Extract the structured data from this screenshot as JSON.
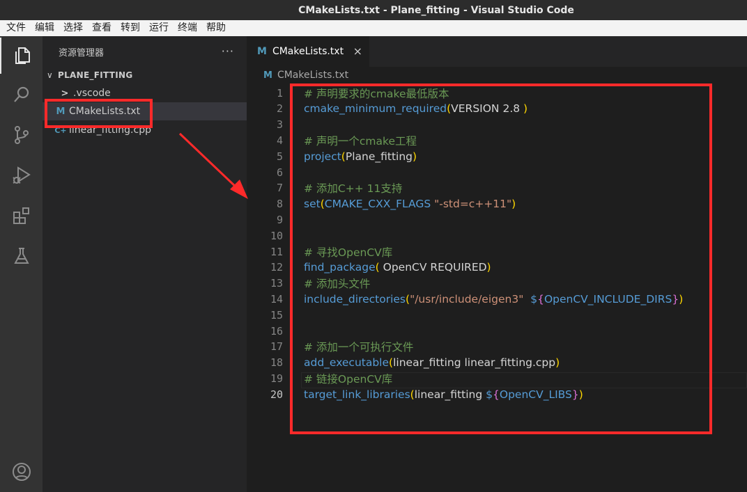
{
  "window": {
    "title": "CMakeLists.txt - Plane_fitting - Visual Studio Code"
  },
  "menu": [
    "文件",
    "编辑",
    "选择",
    "查看",
    "转到",
    "运行",
    "终端",
    "帮助"
  ],
  "activity_bar": [
    "explorer-icon",
    "search-icon",
    "source-control-icon",
    "run-debug-icon",
    "extensions-icon",
    "testing-icon",
    "account-icon"
  ],
  "explorer": {
    "title": "资源管理器",
    "more": "···",
    "folder": "PLANE_FITTING",
    "items": [
      {
        "name": ".vscode",
        "icon": "chevron-right-icon",
        "glyph": ">"
      },
      {
        "name": "CMakeLists.txt",
        "icon": "cmake-file-icon",
        "glyph": "M"
      },
      {
        "name": "linear_fitting.cpp",
        "icon": "cpp-file-icon",
        "glyph": "C+"
      }
    ]
  },
  "editor": {
    "tab": {
      "label": "CMakeLists.txt",
      "icon_glyph": "M",
      "close": "×"
    },
    "breadcrumb": "CMakeLists.txt",
    "current_line": 20,
    "lines": [
      [
        [
          "comment",
          "# 声明要求的cmake最低版本"
        ]
      ],
      [
        [
          "fn",
          "cmake_minimum_required"
        ],
        [
          "paren",
          "("
        ],
        [
          "plain",
          "VERSION 2.8 "
        ],
        [
          "paren",
          ")"
        ]
      ],
      [],
      [
        [
          "comment",
          "# 声明一个cmake工程"
        ]
      ],
      [
        [
          "fn",
          "project"
        ],
        [
          "paren",
          "("
        ],
        [
          "plain",
          "Plane_fitting"
        ],
        [
          "paren",
          ")"
        ]
      ],
      [],
      [
        [
          "comment",
          "# 添加C++ 11支持"
        ]
      ],
      [
        [
          "fn",
          "set"
        ],
        [
          "paren",
          "("
        ],
        [
          "var",
          "CMAKE_CXX_FLAGS"
        ],
        [
          "plain",
          " "
        ],
        [
          "str",
          "\"-std=c++11\""
        ],
        [
          "paren",
          ")"
        ]
      ],
      [],
      [],
      [
        [
          "comment",
          "# 寻找OpenCV库"
        ]
      ],
      [
        [
          "fn",
          "find_package"
        ],
        [
          "paren",
          "("
        ],
        [
          "plain",
          " OpenCV REQUIRED"
        ],
        [
          "paren",
          ")"
        ]
      ],
      [
        [
          "comment",
          "# 添加头文件"
        ]
      ],
      [
        [
          "fn",
          "include_directories"
        ],
        [
          "paren",
          "("
        ],
        [
          "str",
          "\"/usr/include/eigen3\""
        ],
        [
          "plain",
          "  "
        ],
        [
          "var",
          "$"
        ],
        [
          "brace",
          "{"
        ],
        [
          "var",
          "OpenCV_INCLUDE_DIRS"
        ],
        [
          "brace",
          "}"
        ],
        [
          "paren",
          ")"
        ]
      ],
      [],
      [],
      [
        [
          "comment",
          "# 添加一个可执行文件"
        ]
      ],
      [
        [
          "fn",
          "add_executable"
        ],
        [
          "paren",
          "("
        ],
        [
          "plain",
          "linear_fitting linear_fitting.cpp"
        ],
        [
          "paren",
          ")"
        ]
      ],
      [
        [
          "comment",
          "# 链接OpenCV库"
        ]
      ],
      [
        [
          "fn",
          "target_link_libraries"
        ],
        [
          "paren",
          "("
        ],
        [
          "plain",
          "linear_fitting "
        ],
        [
          "var",
          "$"
        ],
        [
          "brace",
          "{"
        ],
        [
          "var",
          "OpenCV_LIBS"
        ],
        [
          "brace",
          "}"
        ],
        [
          "paren",
          ")"
        ]
      ]
    ]
  },
  "colors": {
    "annotation": "#ff2a2a",
    "activity_bar": "#333333",
    "sidebar": "#252526",
    "editor": "#1e1e1e"
  }
}
